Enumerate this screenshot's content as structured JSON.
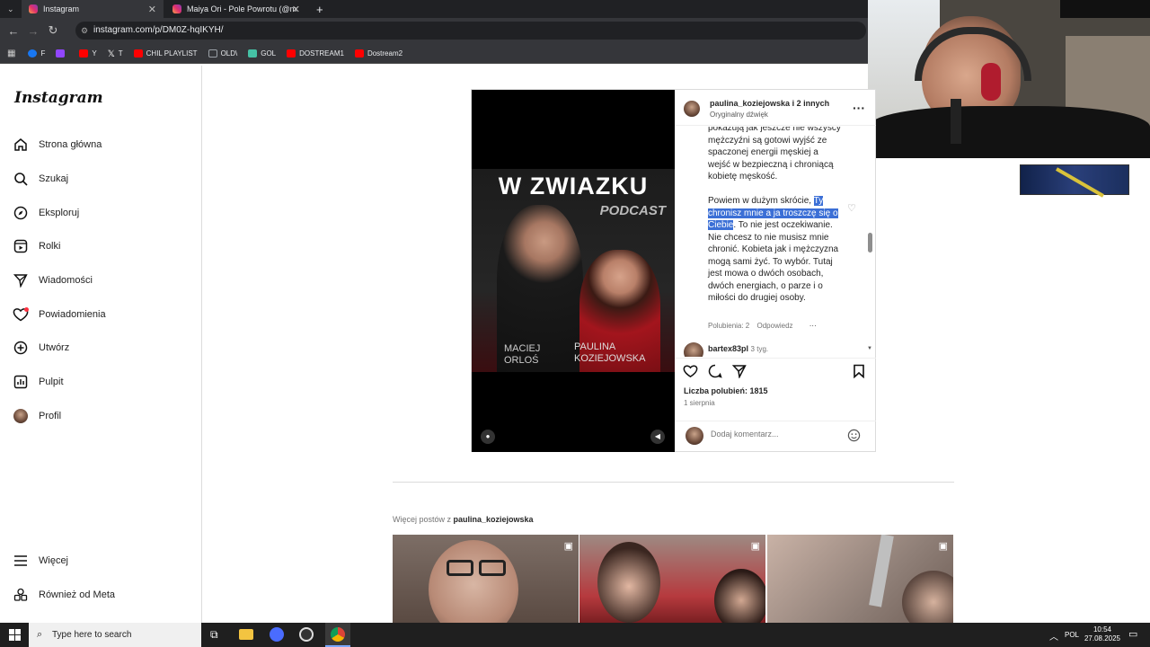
{
  "browser": {
    "tabs": [
      {
        "title": "Instagram",
        "active": true
      },
      {
        "title": "Maiya Ori - Pole Powrotu (@m",
        "active": false
      }
    ],
    "new_tab": "+",
    "url": "instagram.com/p/DM0Z-hqIKYH/",
    "bookmarks": [
      {
        "label": "F",
        "color": "#1877f2"
      },
      {
        "label": "",
        "color": "#9146ff"
      },
      {
        "label": "Y",
        "color": "#ff0000"
      },
      {
        "label": "T",
        "color": "#ffffff"
      },
      {
        "label": "CHIL PLAYLIST",
        "color": "#ff0000"
      },
      {
        "label": "OLD\\",
        "color": "#9aa0a6"
      },
      {
        "label": "GOL",
        "color": "#45c1a5"
      },
      {
        "label": "DOSTREAM1",
        "color": "#ff0000"
      },
      {
        "label": "Dostream2",
        "color": "#ff0000"
      }
    ]
  },
  "sidebar": {
    "logo": "Instagram",
    "items": [
      {
        "label": "Strona główna",
        "icon": "home-icon"
      },
      {
        "label": "Szukaj",
        "icon": "search-icon"
      },
      {
        "label": "Eksploruj",
        "icon": "compass-icon"
      },
      {
        "label": "Rolki",
        "icon": "reels-icon"
      },
      {
        "label": "Wiadomości",
        "icon": "send-icon"
      },
      {
        "label": "Powiadomienia",
        "icon": "heart-icon"
      },
      {
        "label": "Utwórz",
        "icon": "plus-icon"
      },
      {
        "label": "Pulpit",
        "icon": "dashboard-icon"
      },
      {
        "label": "Profil",
        "icon": "avatar-icon"
      }
    ],
    "bottom_items": [
      {
        "label": "Więcej",
        "icon": "menu-icon"
      },
      {
        "label": "Również od Meta",
        "icon": "meta-icon"
      }
    ]
  },
  "post": {
    "author": "paulina_koziejowska",
    "coauthors": "i 2 innych",
    "audio": "Oryginalny dźwięk",
    "poster_title": "W ZWIAZKU",
    "poster_subtitle": "PODCAST",
    "poster_name1": "MACIEJ\nORLOŚ",
    "poster_name2": "PAULINA\nKOZIEJOWSKA",
    "comment_text_top": "pokazują jak jeszcze nie wszyscy mężczyźni są gotowi wyjść ze spaczonej energii męskiej a wejść w bezpieczną i chroniącą kobietę męskość.",
    "comment_text_pre": "Powiem w dużym skrócie, ",
    "comment_text_highlight": "Ty chronisz mnie a ja troszczę się o Ciebie",
    "comment_text_post": ". To nie jest oczekiwanie. Nie chcesz to nie musisz mnie chronić. Kobieta jak i mężczyzna mogą sami żyć. To wybór. Tutaj jest mowa o dwóch osobach, dwóch energiach, o parze i o miłości do drugiej osoby.",
    "comment_likes": "Polubienia: 2",
    "comment_reply": "Odpowiedz",
    "next_commenter": "bartex83pl",
    "next_comment_time": "3 tyg.",
    "likes": "Liczba polubień: 1815",
    "date": "1 sierpnia",
    "add_comment_placeholder": "Dodaj komentarz..."
  },
  "more_posts": {
    "prefix": "Więcej postów z ",
    "user": "paulina_koziejowska"
  },
  "taskbar": {
    "search_placeholder": "Type here to search",
    "language": "POL",
    "time": "10:54",
    "date": "27.08.2025"
  }
}
